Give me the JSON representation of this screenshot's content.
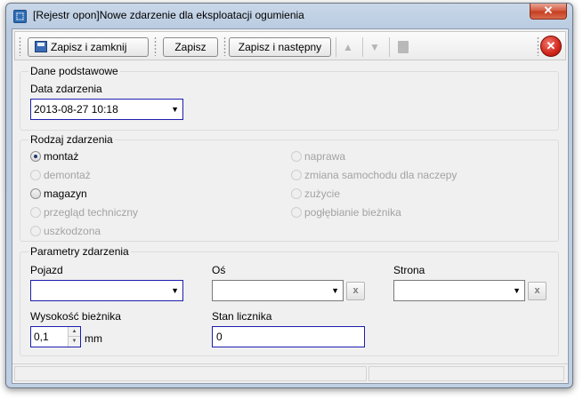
{
  "window": {
    "title": "[Rejestr opon]Nowe zdarzenie dla eksploatacji ogumienia",
    "app_icon": "tire-app-icon",
    "close_glyph": "✕"
  },
  "toolbar": {
    "save_close_label": "Zapisz i zamknij",
    "save_label": "Zapisz",
    "save_next_label": "Zapisz i następny",
    "up_glyph": "▲",
    "down_glyph": "▼",
    "close_glyph": "✕"
  },
  "basic": {
    "group_title": "Dane podstawowe",
    "date_label": "Data zdarzenia",
    "date_value": "2013-08-27 10:18"
  },
  "event_type": {
    "group_title": "Rodzaj zdarzenia",
    "options": [
      {
        "label": "montaż",
        "checked": true,
        "enabled": true
      },
      {
        "label": "demontaż",
        "checked": false,
        "enabled": false
      },
      {
        "label": "magazyn",
        "checked": false,
        "enabled": true
      },
      {
        "label": "przegląd techniczny",
        "checked": false,
        "enabled": false
      },
      {
        "label": "uszkodzona",
        "checked": false,
        "enabled": false
      },
      {
        "label": "naprawa",
        "checked": false,
        "enabled": false
      },
      {
        "label": "zmiana samochodu dla naczepy",
        "checked": false,
        "enabled": false
      },
      {
        "label": "zużycie",
        "checked": false,
        "enabled": false
      },
      {
        "label": "pogłębianie bieżnika",
        "checked": false,
        "enabled": false
      }
    ]
  },
  "params": {
    "group_title": "Parametry zdarzenia",
    "vehicle_label": "Pojazd",
    "vehicle_value": "",
    "axle_label": "Oś",
    "axle_value": "",
    "side_label": "Strona",
    "side_value": "",
    "clear_glyph": "x",
    "tread_label": "Wysokość bieżnika",
    "tread_value": "0,1",
    "tread_unit": "mm",
    "odometer_label": "Stan licznika",
    "odometer_value": "0"
  }
}
